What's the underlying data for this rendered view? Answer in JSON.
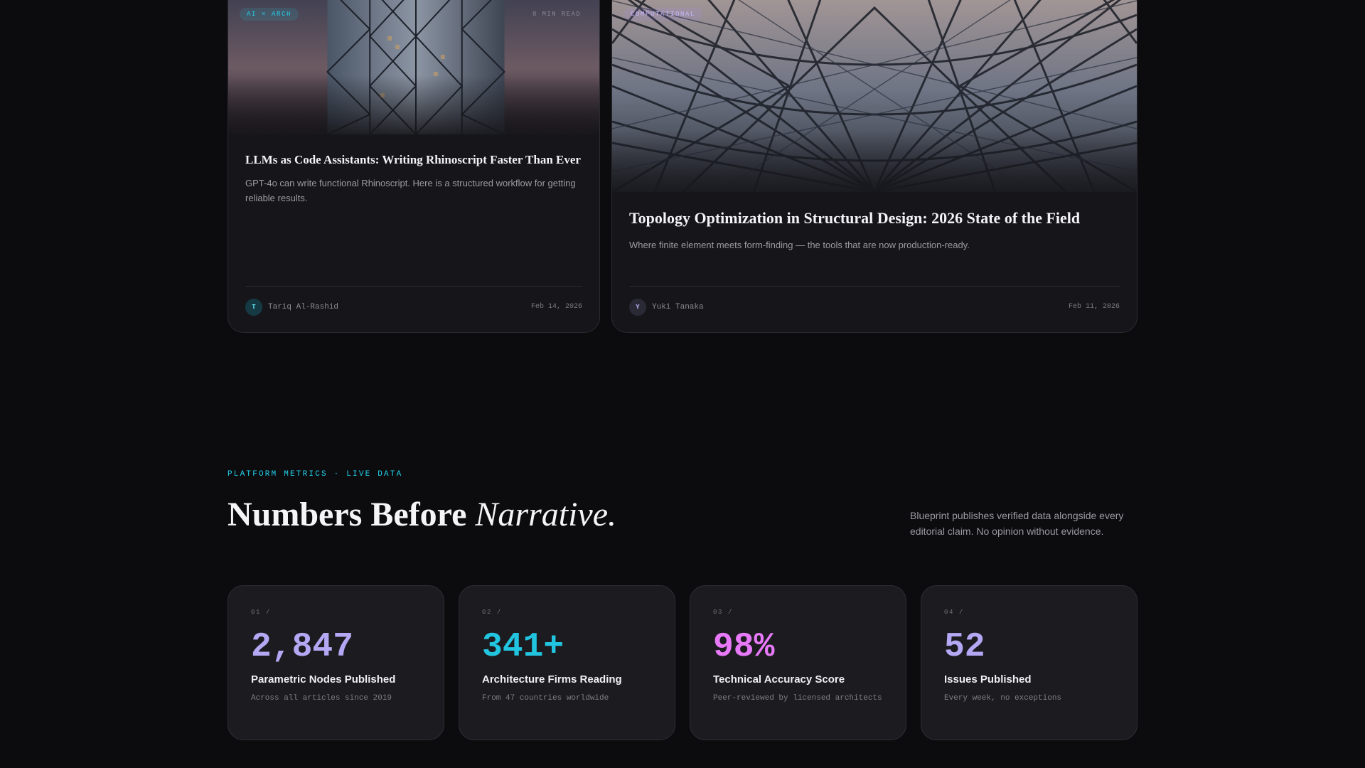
{
  "articles": [
    {
      "tag": "AI × ARCH",
      "read_time": "8 MIN READ",
      "title": "LLMs as Code Assistants: Writing Rhinoscript Faster Than Ever",
      "description": "GPT-4o can write functional Rhinoscript. Here is a structured workflow for getting reliable results.",
      "author_initial": "T",
      "author": "Tariq Al-Rashid",
      "date": "Feb 14, 2026",
      "image": "glass-tower-facade"
    },
    {
      "tag": "COMPUTATIONAL",
      "read_time": "",
      "title": "Topology Optimization in Structural Design: 2026 State of the Field",
      "description": "Where finite element meets form-finding — the tools that are now production-ready.",
      "author_initial": "Y",
      "author": "Yuki Tanaka",
      "date": "Feb 11, 2026",
      "image": "steel-lattice-canopy"
    }
  ],
  "metrics_section": {
    "eyebrow": "PLATFORM METRICS · LIVE DATA",
    "title_plain": "Numbers Before ",
    "title_italic": "Narrative.",
    "description": "Blueprint publishes verified data alongside every editorial claim. No opinion without evidence."
  },
  "metrics": [
    {
      "index": "01 /",
      "value": "2,847",
      "label": "Parametric Nodes Published",
      "sub": "Across all articles since 2019",
      "color": "#b4a8f5"
    },
    {
      "index": "02 /",
      "value": "341+",
      "label": "Architecture Firms Reading",
      "sub": "From 47 countries worldwide",
      "color": "#22c5e0"
    },
    {
      "index": "03 /",
      "value": "98%",
      "label": "Technical Accuracy Score",
      "sub": "Peer-reviewed by licensed architects",
      "color": "#e879f9"
    },
    {
      "index": "04 /",
      "value": "52",
      "label": "Issues Published",
      "sub": "Every week, no exceptions",
      "color": "#b4a8f5"
    }
  ]
}
